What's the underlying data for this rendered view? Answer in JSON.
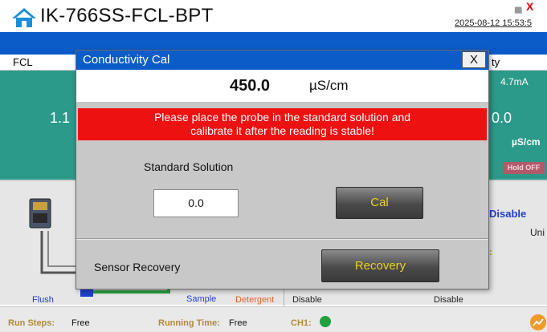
{
  "header": {
    "title": "IK-766SS-FCL-BPT",
    "datetime": "2025-08-12 15:53:5",
    "minimize_symbol": "▅",
    "close_symbol": "X",
    "home_icon": "home-icon"
  },
  "background": {
    "left_label": "FCL",
    "right_label": "ty",
    "left_value": "1.1",
    "right_value": "0.0",
    "right_current": "4.7mA",
    "right_unit": "µS/cm",
    "hold_badge": "Hold OFF",
    "disable_blue": "Disable",
    "uni_text": "Uni",
    "colon_text": ":",
    "flush_label": "Flush",
    "sample_label": "Sample",
    "detergent_label": "Detergent",
    "disable_1": "Disable",
    "disable_2": "Disable"
  },
  "status_bar": {
    "run_steps_label": "Run Steps:",
    "run_steps_value": "Free",
    "running_time_label": "Running Time:",
    "running_time_value": "Free",
    "ch1_label": "CH1:",
    "trend_icon": "trend-icon"
  },
  "modal": {
    "title": "Conductivity Cal",
    "close_label": "X",
    "reading_value": "450.0",
    "reading_unit": "µS/cm",
    "alert_line1": "Please place the probe in the standard solution and",
    "alert_line2": "calibrate it after the reading is stable!",
    "standard_solution_label": "Standard Solution",
    "standard_solution_value": "0.0",
    "cal_button": "Cal",
    "sensor_recovery_label": "Sensor Recovery",
    "recovery_button": "Recovery"
  },
  "colors": {
    "brand_blue": "#0b5cc9",
    "teal": "#2b9a8a",
    "alert_red": "#ee1111",
    "button_text": "#e8d220",
    "close_red": "#e00000"
  }
}
